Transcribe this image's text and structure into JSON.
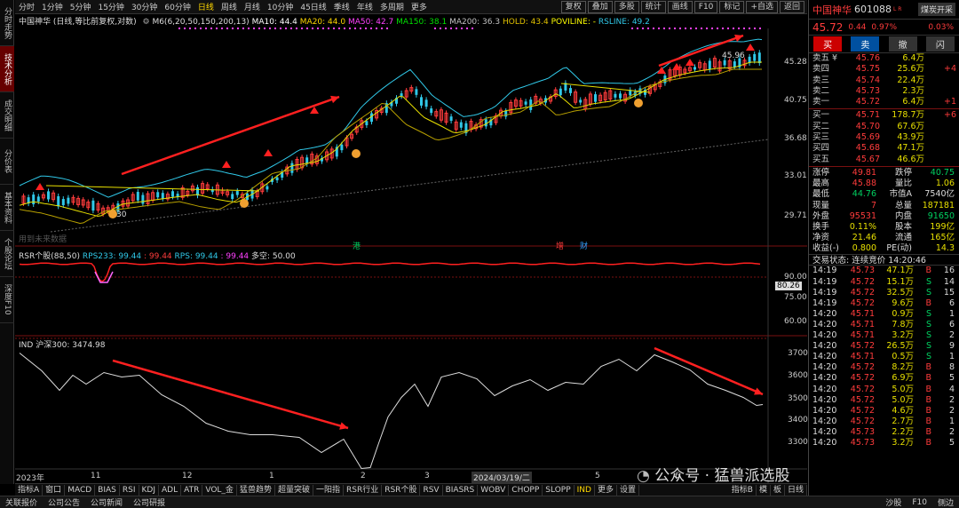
{
  "sidebar": [
    "分时走势",
    "技术分析",
    "成交明细",
    "分价表",
    "基本资料",
    "个股论坛",
    "深度F10"
  ],
  "periods": [
    "分时",
    "1分钟",
    "5分钟",
    "15分钟",
    "30分钟",
    "60分钟",
    "日线",
    "周线",
    "月线",
    "10分钟",
    "45日线",
    "季线",
    "年线",
    "多周期",
    "更多"
  ],
  "active_period": "日线",
  "toolbar_right": [
    "复权",
    "叠加",
    "多股",
    "统计",
    "画线",
    "F10",
    "标记",
    "+自选",
    "返回"
  ],
  "chart": {
    "title": "中国神华 (日线,等比前复权,对数)",
    "ma_label": "M6(6,20,50,150,200,13)",
    "ma10": "MA10: 44.4",
    "ma20": "MA20: 44.0",
    "ma50": "MA50: 42.7",
    "ma150": "MA150: 38.1",
    "ma200": "MA200: 36.3",
    "hold": "HOLD: 43.4",
    "poviline": "POVILINE: -",
    "rsline": "RSLINE: 49.2",
    "low_label": "30",
    "high_label": "45.96",
    "watermark": "用到未来数据",
    "price_ticks": [
      "45.28",
      "40.75",
      "36.68",
      "33.01",
      "29.71"
    ],
    "markers": {
      "gang": "港",
      "zeng": "增",
      "cai": "财"
    }
  },
  "rsr": {
    "title": "RSR个股(88,50)",
    "rps233": "RPS233: 99.44",
    "v2": ": 99.44",
    "rps": "RPS: 99.44",
    "v4": ": 99.44",
    "duokong": "多空: 50.00",
    "ticks": [
      "90.00",
      "80.26",
      "75.00",
      "60.00"
    ]
  },
  "ind": {
    "title": "IND",
    "value": "沪深300: 3474.98",
    "ticks": [
      "3700",
      "3600",
      "3500",
      "3400",
      "3300"
    ]
  },
  "x_labels": [
    "2023年",
    "11",
    "12",
    "1",
    "2",
    "3",
    "2024/03/19/二",
    "5",
    "6"
  ],
  "bottom_tabs": [
    "指标A",
    "窗口",
    "MACD",
    "BIAS",
    "RSI",
    "KDJ",
    "ADL",
    "ATR",
    "VOL_金",
    "猛兽趋势",
    "超量突破",
    "一阳指",
    "RSR行业",
    "RSR个股",
    "RSV",
    "BIASRS",
    "WOBV",
    "CHOPP",
    "SLOPP",
    "IND",
    "更多",
    "设置"
  ],
  "active_tab": "IND",
  "bottom_right": [
    "指标B",
    "模",
    "板",
    "日线"
  ],
  "status_left": [
    "关联报价",
    "公司公告",
    "公司新闻",
    "公司研报"
  ],
  "status_right": [
    "沙股",
    "F10",
    "侧边"
  ],
  "stock": {
    "name": "中国神华",
    "code": "601088",
    "tag": "L R",
    "board": "煤炭开采",
    "price": "45.72",
    "change": "0.44",
    "pct": "0.97%",
    "ratio": "0.03%"
  },
  "trade_buttons": [
    "买",
    "卖",
    "撤",
    "闪"
  ],
  "asks": [
    {
      "label": "卖五 ¥",
      "price": "45.76",
      "vol": "6.4万",
      "chg": ""
    },
    {
      "label": "卖四",
      "price": "45.75",
      "vol": "25.6万",
      "chg": "+4"
    },
    {
      "label": "卖三",
      "price": "45.74",
      "vol": "22.4万",
      "chg": ""
    },
    {
      "label": "卖二",
      "price": "45.73",
      "vol": "2.3万",
      "chg": ""
    },
    {
      "label": "卖一",
      "price": "45.72",
      "vol": "6.4万",
      "chg": "+1"
    }
  ],
  "bids": [
    {
      "label": "买一",
      "price": "45.71",
      "vol": "178.7万",
      "chg": "+6"
    },
    {
      "label": "买二",
      "price": "45.70",
      "vol": "67.6万",
      "chg": ""
    },
    {
      "label": "买三",
      "price": "45.69",
      "vol": "43.9万",
      "chg": ""
    },
    {
      "label": "买四",
      "price": "45.68",
      "vol": "47.1万",
      "chg": ""
    },
    {
      "label": "买五",
      "price": "45.67",
      "vol": "46.6万",
      "chg": ""
    }
  ],
  "quotes": [
    [
      "涨停",
      "49.81",
      "跌停",
      "40.75"
    ],
    [
      "最高",
      "45.88",
      "量比",
      "1.06"
    ],
    [
      "最低",
      "44.76",
      "市值A",
      "7540亿"
    ],
    [
      "现量",
      "7",
      "总量",
      "187181"
    ],
    [
      "外盘",
      "95531",
      "内盘",
      "91650"
    ],
    [
      "换手",
      "0.11%",
      "股本",
      "199亿"
    ],
    [
      "净资",
      "21.46",
      "流通",
      "165亿"
    ],
    [
      "收益(-)",
      "0.800",
      "PE(动)",
      "14.3"
    ]
  ],
  "trade_status": "交易状态: 连续竞价 14:20:46",
  "ticks": [
    [
      "14:19",
      "45.73",
      "47.1万",
      "B",
      "16"
    ],
    [
      "14:19",
      "45.72",
      "15.1万",
      "S",
      "14"
    ],
    [
      "14:19",
      "45.72",
      "32.5万",
      "S",
      "15"
    ],
    [
      "14:19",
      "45.72",
      "9.6万",
      "B",
      "6"
    ],
    [
      "14:20",
      "45.71",
      "0.9万",
      "S",
      "1"
    ],
    [
      "14:20",
      "45.71",
      "7.8万",
      "S",
      "6"
    ],
    [
      "14:20",
      "45.71",
      "3.2万",
      "S",
      "2"
    ],
    [
      "14:20",
      "45.72",
      "26.5万",
      "S",
      "9"
    ],
    [
      "14:20",
      "45.71",
      "0.5万",
      "S",
      "1"
    ],
    [
      "14:20",
      "45.72",
      "8.2万",
      "B",
      "8"
    ],
    [
      "14:20",
      "45.72",
      "6.9万",
      "B",
      "5"
    ],
    [
      "14:20",
      "45.72",
      "5.0万",
      "B",
      "4"
    ],
    [
      "14:20",
      "45.72",
      "5.0万",
      "B",
      "2"
    ],
    [
      "14:20",
      "45.72",
      "4.6万",
      "B",
      "2"
    ],
    [
      "14:20",
      "45.72",
      "2.7万",
      "B",
      "1"
    ],
    [
      "14:20",
      "45.73",
      "2.2万",
      "B",
      "2"
    ],
    [
      "14:20",
      "45.73",
      "3.2万",
      "B",
      "5"
    ]
  ],
  "wechat": "公众号 · 猛兽派选股"
}
